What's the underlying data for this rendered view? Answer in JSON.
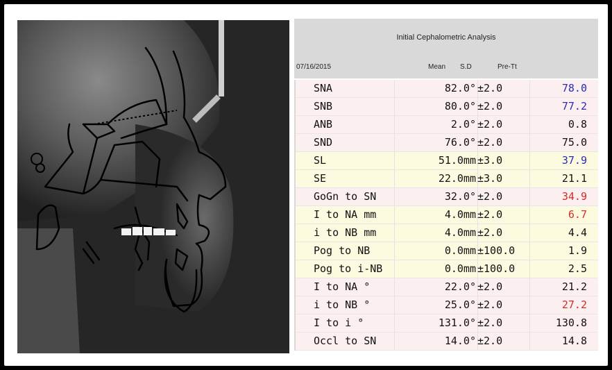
{
  "analysis": {
    "title": "Initial Cephalometric Analysis",
    "date": "07/16/2015",
    "columns": {
      "mean": "Mean",
      "sd": "S.D",
      "pre": "Pre-Tt"
    },
    "rows": [
      {
        "name": "SNA",
        "mean": "82.0°",
        "sd": "±2.0",
        "value": "78.0",
        "value_color": "blue",
        "bg": "pink"
      },
      {
        "name": "SNB",
        "mean": "80.0°",
        "sd": "±2.0",
        "value": "77.2",
        "value_color": "blue",
        "bg": "pink"
      },
      {
        "name": "ANB",
        "mean": "2.0°",
        "sd": "±2.0",
        "value": "0.8",
        "value_color": "black",
        "bg": "pink"
      },
      {
        "name": "SND",
        "mean": "76.0°",
        "sd": "±2.0",
        "value": "75.0",
        "value_color": "black",
        "bg": "pink"
      },
      {
        "name": "SL",
        "mean": "51.0mm",
        "sd": "±3.0",
        "value": "37.9",
        "value_color": "blue",
        "bg": "yellow"
      },
      {
        "name": "SE",
        "mean": "22.0mm",
        "sd": "±3.0",
        "value": "21.1",
        "value_color": "black",
        "bg": "yellow"
      },
      {
        "name": "GoGn to SN",
        "mean": "32.0°",
        "sd": "±2.0",
        "value": "34.9",
        "value_color": "red",
        "bg": "pink"
      },
      {
        "name": "I to NA mm",
        "mean": "4.0mm",
        "sd": "±2.0",
        "value": "6.7",
        "value_color": "red",
        "bg": "yellow"
      },
      {
        "name": "i to NB mm",
        "mean": "4.0mm",
        "sd": "±2.0",
        "value": "4.4",
        "value_color": "black",
        "bg": "yellow"
      },
      {
        "name": "Pog to NB",
        "mean": "0.0mm",
        "sd": "±100.0",
        "value": "1.9",
        "value_color": "black",
        "bg": "yellow"
      },
      {
        "name": "Pog to i-NB",
        "mean": "0.0mm",
        "sd": "±100.0",
        "value": "2.5",
        "value_color": "black",
        "bg": "yellow"
      },
      {
        "name": "I to NA °",
        "mean": "22.0°",
        "sd": "±2.0",
        "value": "21.2",
        "value_color": "black",
        "bg": "pink"
      },
      {
        "name": "i to NB °",
        "mean": "25.0°",
        "sd": "±2.0",
        "value": "27.2",
        "value_color": "red",
        "bg": "pink"
      },
      {
        "name": "I to i °",
        "mean": "131.0°",
        "sd": "±2.0",
        "value": "130.8",
        "value_color": "black",
        "bg": "pink"
      },
      {
        "name": "Occl to SN",
        "mean": "14.0°",
        "sd": "±2.0",
        "value": "14.8",
        "value_color": "black",
        "bg": "pink"
      }
    ]
  },
  "xray": {
    "image_kind": "lateral-cephalometric-radiograph-with-tracing"
  },
  "colors": {
    "blue": "#2a2ab8",
    "red": "#d42a2a",
    "black": "#111111"
  }
}
